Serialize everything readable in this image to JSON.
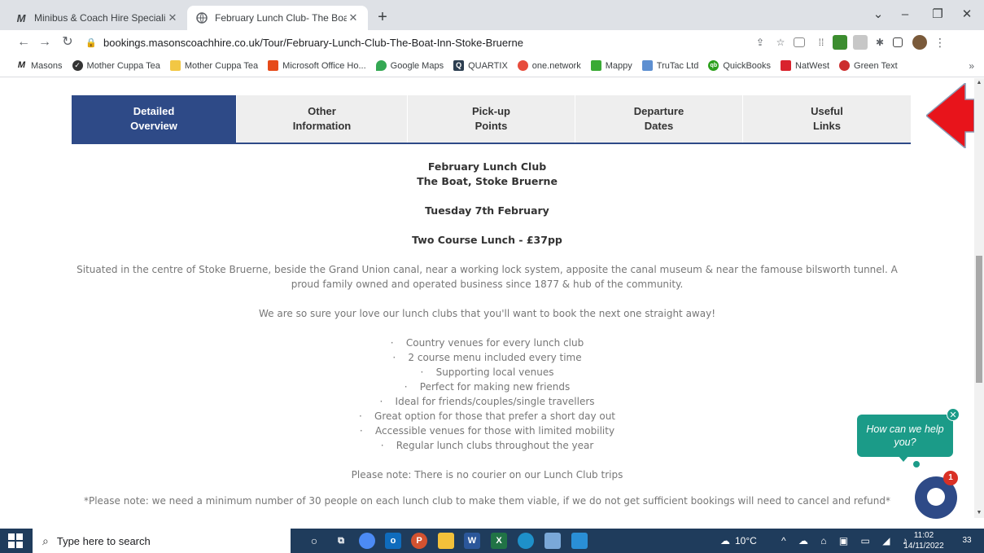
{
  "browser": {
    "tabs": [
      {
        "title": "Minibus & Coach Hire Specialists",
        "favicon": "M"
      },
      {
        "title": "February Lunch Club- The Boat In",
        "favicon": "globe"
      }
    ],
    "url": "bookings.masonscoachhire.co.uk/Tour/February-Lunch-Club-The-Boat-Inn-Stoke-Bruerne",
    "bookmarks": [
      {
        "label": "Masons",
        "icon": "M",
        "color": "#222222"
      },
      {
        "label": "Mother Cuppa Tea",
        "icon": "✓",
        "color": "#333333"
      },
      {
        "label": "Mother Cuppa Tea",
        "icon": "",
        "color": "#f2c744"
      },
      {
        "label": "Microsoft Office Ho...",
        "icon": "",
        "color": "#e64a19"
      },
      {
        "label": "Google Maps",
        "icon": "",
        "color": "#34a853"
      },
      {
        "label": "QUARTIX",
        "icon": "Q",
        "color": "#2c3e50"
      },
      {
        "label": "one.network",
        "icon": "",
        "color": "#e74c3c"
      },
      {
        "label": "Mappy",
        "icon": "",
        "color": "#3aaa35"
      },
      {
        "label": "TruTac Ltd",
        "icon": "",
        "color": "#5d8fd1"
      },
      {
        "label": "QuickBooks",
        "icon": "qb",
        "color": "#2ca01c"
      },
      {
        "label": "NatWest",
        "icon": "",
        "color": "#d9232d"
      },
      {
        "label": "Green Text",
        "icon": "",
        "color": "#cc2e2e"
      }
    ]
  },
  "page": {
    "tabs": [
      {
        "label": "Detailed\nOverview",
        "active": true
      },
      {
        "label": "Other\nInformation",
        "active": false
      },
      {
        "label": "Pick-up\nPoints",
        "active": false
      },
      {
        "label": "Departure\nDates",
        "active": false
      },
      {
        "label": "Useful\nLinks",
        "active": false
      }
    ],
    "heading1": "February Lunch Club",
    "heading2": "The Boat, Stoke Bruerne",
    "date": "Tuesday 7th February",
    "price": "Two Course Lunch - £37pp",
    "description": "Situated in the centre of Stoke Bruerne, beside the Grand Union canal, near a working lock system, apposite the canal museum & near the famouse bilsworth tunnel. A proud family owned and operated business since 1877 & hub of the community.",
    "tagline": "We are so sure your love our lunch clubs that you'll want to book the next one straight away!",
    "features": [
      "Country venues for every lunch club",
      "2 course menu included every time",
      "Supporting local venues",
      "Perfect for making new friends",
      "Ideal for friends/couples/single travellers",
      "Great option for those that prefer a short day out",
      "Accessible venues for those with limited mobility",
      "Regular lunch clubs throughout the year"
    ],
    "note1": "Please note: There is no courier on our Lunch Club trips",
    "note2": "*Please note: we need a minimum number of 30 people on each lunch club to make them viable, if we do not get sufficient bookings will need to cancel and refund*"
  },
  "chat": {
    "prompt": "How can we help you?",
    "badge": "1"
  },
  "taskbar": {
    "search_placeholder": "Type here to search",
    "weather": "10°C",
    "time": "11:02",
    "date": "14/11/2022",
    "notifications": "33"
  },
  "colors": {
    "brand_blue": "#2e4a87",
    "chat_teal": "#1b9b88",
    "arrow_red": "#e8141b"
  }
}
